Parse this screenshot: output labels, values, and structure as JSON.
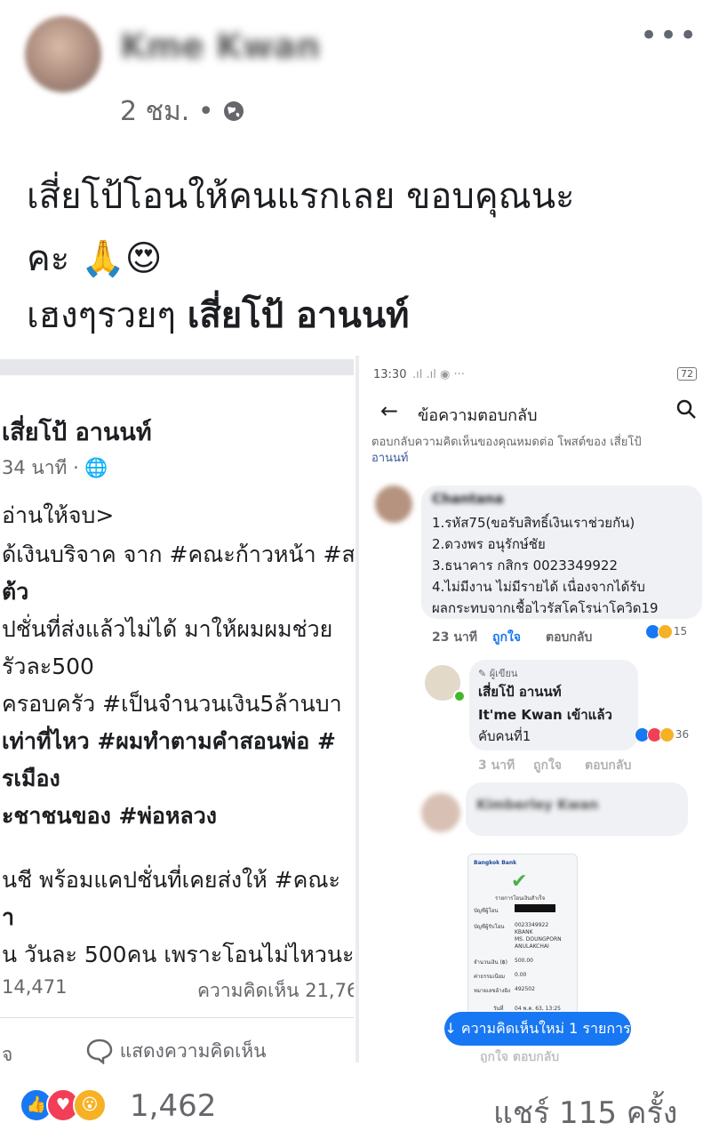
{
  "post": {
    "author": "Kme Kwan",
    "time": "2 ชม. •",
    "caption_line1": "เสี่ยโป้โอนให้คนแรกเลย ขอบคุณนะ",
    "caption_line2": "คะ",
    "caption_line3_prefix": "เฮงๆรวยๆ",
    "caption_line3_bold": "เสี่ยโป้ อานนท์",
    "emoji_pray": "🙏",
    "emoji_love": "😍"
  },
  "left_shot": {
    "author": "เสี่ยโป้ อานนท์",
    "time": "34 นาที · ",
    "lines": [
      "อ่านให้จบ>",
      "ด้เงินบริจาค จาก #คณะก้าวหน้า #ส",
      "ต้ว",
      "ปชั่นที่ส่งแล้วไม่ได้ มาให้ผมผมช่วย",
      "รัวละ500",
      "ครอบครัว #เป็นจำนวนเงิน5ล้านบา",
      "เท่าที่ไหว #ผมทำตามคำสอนพ่อ #",
      "รเมือง",
      "ะชาชนของ #พ่อหลวง",
      "นชี พร้อมแคปชั่นที่เคยส่งให้ #คณะ",
      "า",
      "น วันละ 500คน เพราะโอนไม่ไหวนะ"
    ],
    "reactions_count": "14,471",
    "comments_count": "ความคิดเห็น 21,76",
    "like_label": "จ",
    "comment_label": "แสดงความคิดเห็น"
  },
  "right_shot": {
    "status_time": "13:30",
    "battery": "72",
    "header_title": "ข้อความตอบกลับ",
    "context_line1": "ตอบกลับความคิดเห็นของคุณหมดต่อ โพสต์ของ เสี่ยโป้",
    "context_line2": "อานนท์",
    "comment1": {
      "author": "Chantana",
      "lines": [
        "1.รหัส75(ขอรับสิทธิ์เงินเราช่วยกัน)",
        "2.ดวงพร อนุรักษ์ชัย",
        "3.ธนาคาร กสิกร 0023349922",
        "4.ไม่มีงาน ไม่มีรายได้ เนื่องจากได้รับ",
        "ผลกระทบจากเชื้อไวรัสโคโรน่าโควิด19"
      ],
      "time": "23 นาที",
      "like": "ถูกใจ",
      "reply": "ตอบกลับ",
      "react_count": "15"
    },
    "comment2": {
      "badge": "ผู้เขียน",
      "author": "เสี่ยโป้ อานนท์",
      "line1": "It'me Kwan เข้าแล้ว",
      "line2": "คับคนที่1",
      "time": "3 นาที",
      "like": "ถูกใจ",
      "reply": "ตอบกลับ",
      "react_count": "36"
    },
    "comment3": {
      "author": "Kimberley Kwan"
    },
    "receipt": {
      "bank": "Bangkok Bank",
      "title": "รายการโอนเงินสำเร็จ",
      "from_label": "บัญชีผู้โอน",
      "to_label": "บัญชีผู้รับโอน",
      "to_value1": "0023349922",
      "to_value2": "KBANK",
      "to_value3": "MS. DOUNGPORN",
      "to_value4": "ANULAKCHAI",
      "amount_label": "จำนวนเงิน (฿)",
      "amount_value": "500.00",
      "fee_label": "ค่าธรรมเนียม",
      "fee_value": "0.00",
      "ref_label": "หมายเลขอ้างอิง",
      "ref_value": "492502",
      "date_label": "วันที่",
      "date_value": "04 พ.ค. 63, 13:25"
    },
    "new_comments_pill": "↓ ความคิดเห็นใหม่ 1 รายการ",
    "bottom_fade": "ถูกใจ   ตอบกลับ"
  },
  "footer": {
    "reaction_count": "1,462",
    "shares": "แชร์ 115 ครั้ง"
  },
  "colors": {
    "fb_blue": "#1877f2",
    "link_blue": "#385898",
    "like_blue": "#1877f2",
    "love_red": "#f33e58",
    "wow_yellow": "#f7b125"
  }
}
